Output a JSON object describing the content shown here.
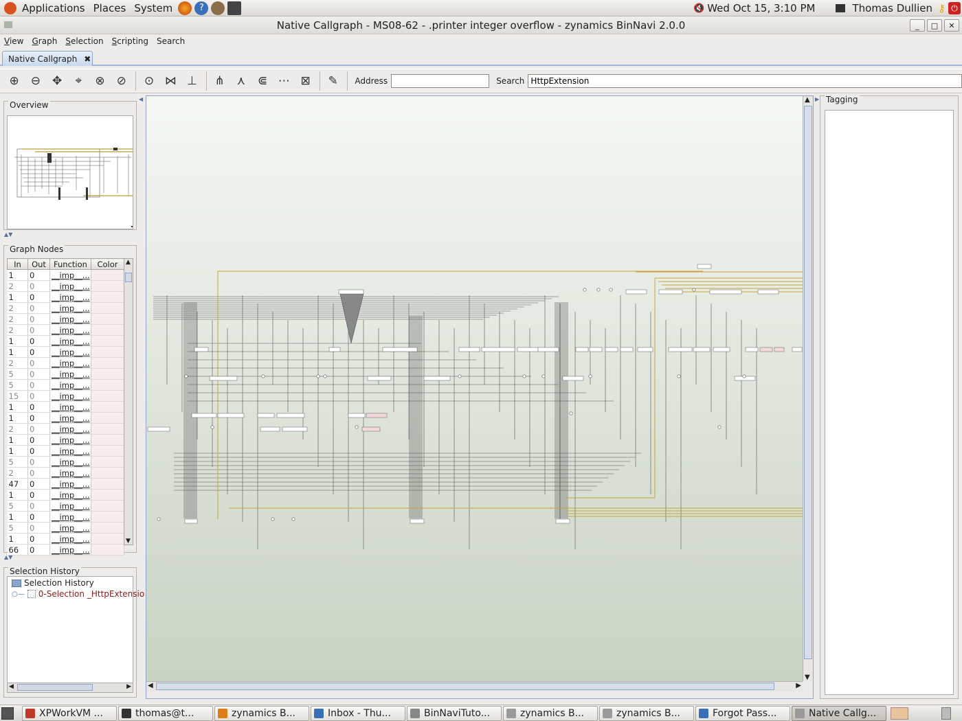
{
  "top_panel": {
    "menus": [
      "Applications",
      "Places",
      "System"
    ],
    "clock": "Wed Oct 15,  3:10 PM",
    "user": "Thomas Dullien"
  },
  "window": {
    "title": "Native Callgraph - MS08-62 - .printer integer overflow - zynamics BinNavi 2.0.0",
    "controls": [
      "_",
      "□",
      "✕"
    ]
  },
  "menubar": [
    {
      "u": "V",
      "rest": "iew"
    },
    {
      "u": "G",
      "rest": "raph"
    },
    {
      "u": "S",
      "rest": "election"
    },
    {
      "u": "S",
      "rest": "cripting"
    },
    {
      "u": "",
      "rest": "Search"
    }
  ],
  "tab": {
    "label": "Native Callgraph",
    "close": "✖"
  },
  "toolbar": {
    "address_label": "Address",
    "address_value": "",
    "search_label": "Search",
    "search_value": "HttpExtension",
    "icons": [
      "zoom-in-icon",
      "zoom-out-icon",
      "zoom-fit-icon",
      "zoom-selection-icon",
      "zoom-reset-icon",
      "lock-zoom-icon",
      "circular-layout-icon",
      "orthogonal-layout-icon",
      "hierarchic-layout-icon",
      "select-children-icon",
      "select-parents-icon",
      "select-successors-icon",
      "select-predecessors-icon",
      "delete-selection-icon",
      "color-nodes-icon"
    ]
  },
  "overview": {
    "title": "Overview"
  },
  "graph_nodes": {
    "title": "Graph Nodes",
    "columns": [
      "In",
      "Out",
      "Function",
      "Color"
    ],
    "rows": [
      {
        "in": "1",
        "out": "0",
        "fn": "__imp__..."
      },
      {
        "in": "2",
        "out": "0",
        "fn": "__imp__..."
      },
      {
        "in": "1",
        "out": "0",
        "fn": "__imp__..."
      },
      {
        "in": "2",
        "out": "0",
        "fn": "__imp__..."
      },
      {
        "in": "2",
        "out": "0",
        "fn": "__imp__..."
      },
      {
        "in": "2",
        "out": "0",
        "fn": "__imp__..."
      },
      {
        "in": "1",
        "out": "0",
        "fn": "__imp__..."
      },
      {
        "in": "1",
        "out": "0",
        "fn": "__imp__..."
      },
      {
        "in": "2",
        "out": "0",
        "fn": "__imp__..."
      },
      {
        "in": "5",
        "out": "0",
        "fn": "__imp__..."
      },
      {
        "in": "5",
        "out": "0",
        "fn": "__imp__..."
      },
      {
        "in": "15",
        "out": "0",
        "fn": "__imp__..."
      },
      {
        "in": "1",
        "out": "0",
        "fn": "__imp__..."
      },
      {
        "in": "1",
        "out": "0",
        "fn": "__imp__..."
      },
      {
        "in": "2",
        "out": "0",
        "fn": "__imp__..."
      },
      {
        "in": "1",
        "out": "0",
        "fn": "__imp__..."
      },
      {
        "in": "1",
        "out": "0",
        "fn": "__imp__..."
      },
      {
        "in": "5",
        "out": "0",
        "fn": "__imp__..."
      },
      {
        "in": "2",
        "out": "0",
        "fn": "__imp__..."
      },
      {
        "in": "47",
        "out": "0",
        "fn": "__imp__..."
      },
      {
        "in": "1",
        "out": "0",
        "fn": "__imp__..."
      },
      {
        "in": "5",
        "out": "0",
        "fn": "__imp__..."
      },
      {
        "in": "1",
        "out": "0",
        "fn": "__imp__..."
      },
      {
        "in": "5",
        "out": "0",
        "fn": "__imp__..."
      },
      {
        "in": "1",
        "out": "0",
        "fn": "__imp__..."
      },
      {
        "in": "66",
        "out": "0",
        "fn": "__imp__..."
      }
    ]
  },
  "selection_history": {
    "title": "Selection History",
    "root": "Selection History",
    "item": "0-Selection _HttpExtensio"
  },
  "tagging": {
    "title": "Tagging"
  },
  "taskbar": [
    {
      "label": "XPWorkVM ...",
      "color": "#c0392b"
    },
    {
      "label": "thomas@t...",
      "color": "#333333"
    },
    {
      "label": "zynamics B...",
      "color": "#e07b1a"
    },
    {
      "label": "Inbox - Thu...",
      "color": "#3a6fb5"
    },
    {
      "label": "BinNaviTuto...",
      "color": "#888888"
    },
    {
      "label": "zynamics B...",
      "color": "#9a9a9a"
    },
    {
      "label": "zynamics B...",
      "color": "#9a9a9a"
    },
    {
      "label": "Forgot Pass...",
      "color": "#3a6fb5"
    },
    {
      "label": "Native Callg...",
      "color": "#9a9a9a"
    }
  ],
  "colors": {
    "accent": "#8ea6cc",
    "highlight_edge": "#c8a43a",
    "node_fill": "#ffffff",
    "pink_node": "#f3d9d9"
  }
}
